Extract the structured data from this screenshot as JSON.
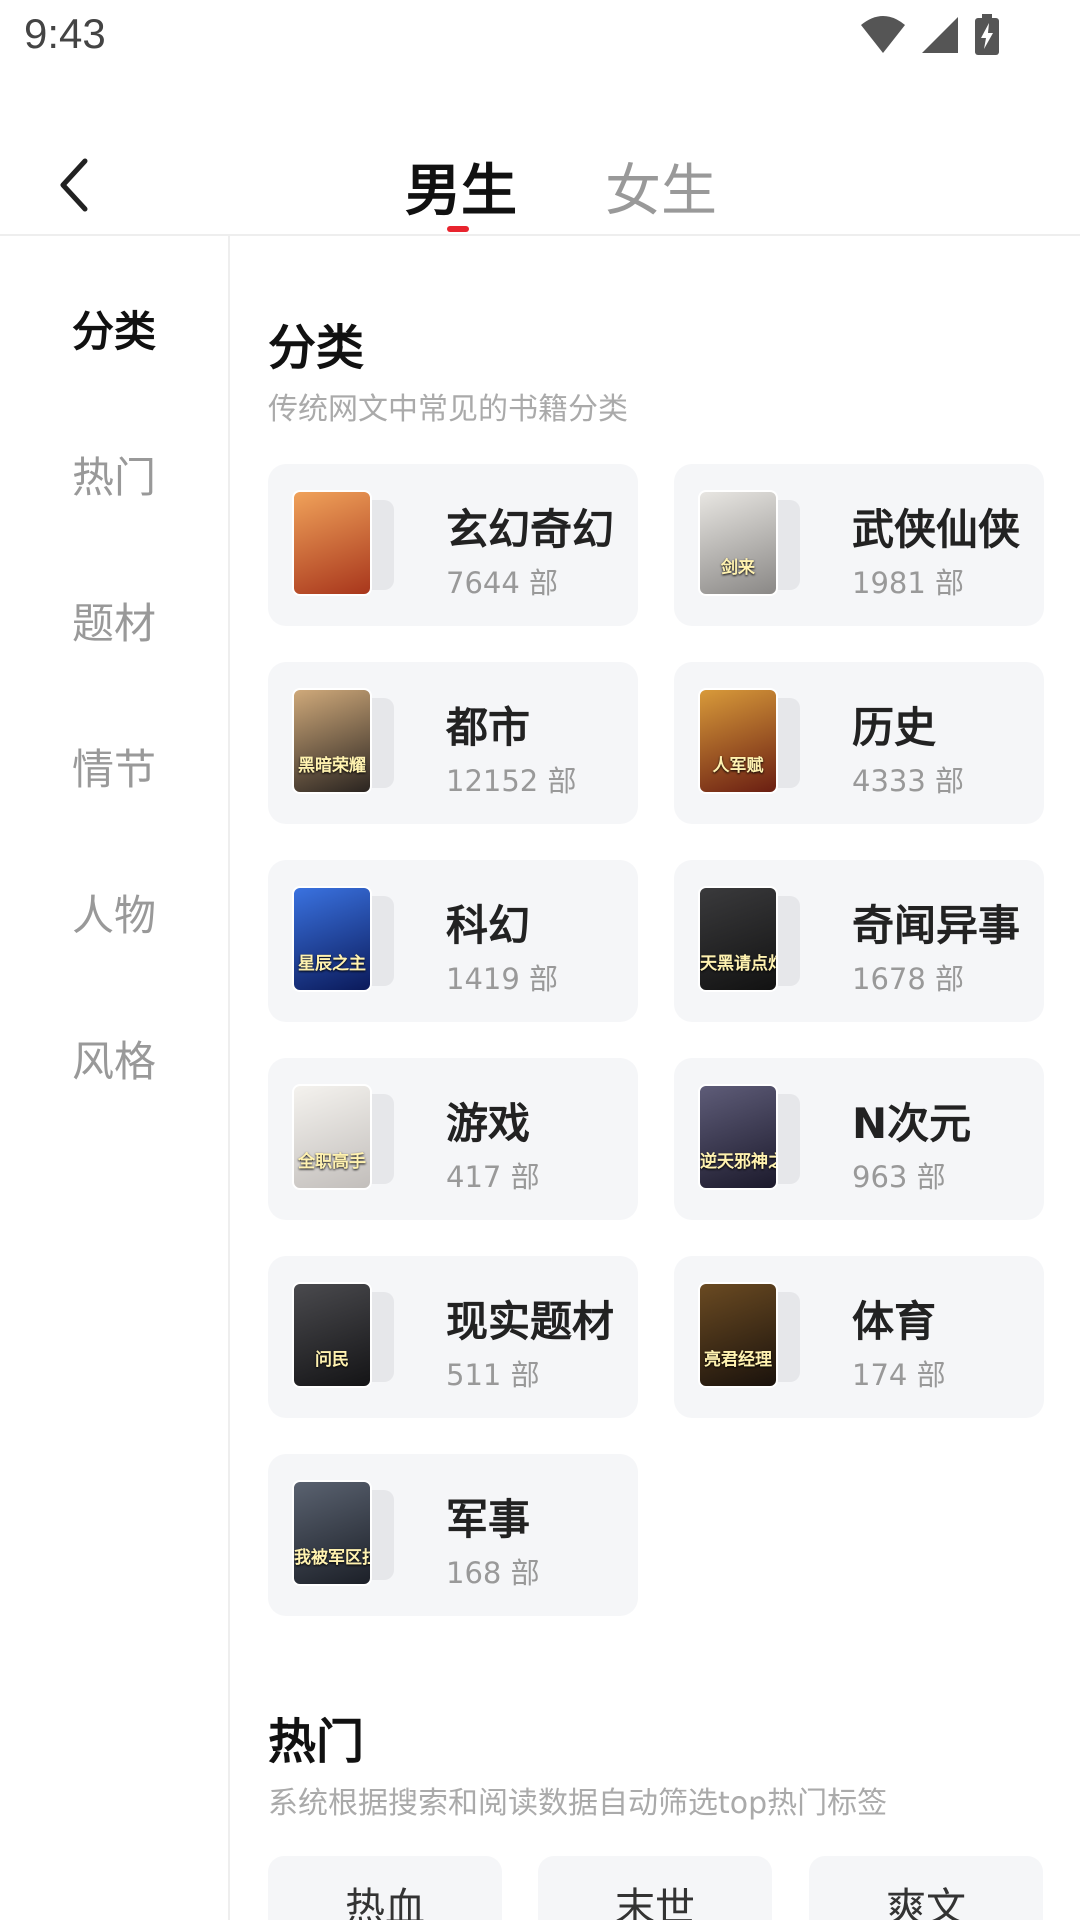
{
  "status_bar": {
    "time": "9:43"
  },
  "tabs": [
    {
      "label": "男生",
      "active": true
    },
    {
      "label": "女生",
      "active": false
    }
  ],
  "sidebar": {
    "items": [
      {
        "label": "分类",
        "active": true
      },
      {
        "label": "热门",
        "active": false
      },
      {
        "label": "题材",
        "active": false
      },
      {
        "label": "情节",
        "active": false
      },
      {
        "label": "人物",
        "active": false
      },
      {
        "label": "风格",
        "active": false
      }
    ]
  },
  "category_section": {
    "title": "分类",
    "subtitle": "传统网文中常见的书籍分类",
    "items": [
      {
        "name": "玄幻奇幻",
        "count": "7644 部",
        "cover_colors": [
          "#f0a25a",
          "#a8361c"
        ]
      },
      {
        "name": "武侠仙侠",
        "count": "1981 部",
        "cover_colors": [
          "#e8e6e2",
          "#8a8886"
        ],
        "cover_text": "剑来"
      },
      {
        "name": "都市",
        "count": "12152 部",
        "cover_colors": [
          "#cfa97a",
          "#2a2420"
        ],
        "cover_text": "黑暗荣耀"
      },
      {
        "name": "历史",
        "count": "4333 部",
        "cover_colors": [
          "#d89a3a",
          "#6a1e12"
        ],
        "cover_text": "人军赋"
      },
      {
        "name": "科幻",
        "count": "1419 部",
        "cover_colors": [
          "#3a72e0",
          "#0b1a5a"
        ],
        "cover_text": "星辰之主"
      },
      {
        "name": "奇闻异事",
        "count": "1678 部",
        "cover_colors": [
          "#3a3a3c",
          "#121212"
        ],
        "cover_text": "天黑请点灯"
      },
      {
        "name": "游戏",
        "count": "417 部",
        "cover_colors": [
          "#f4f2ee",
          "#c2bebb"
        ],
        "cover_text": "全职高手"
      },
      {
        "name": "N次元",
        "count": "963 部",
        "cover_colors": [
          "#5e5c78",
          "#1c1a2c"
        ],
        "cover_text": "逆天邪神之续章"
      },
      {
        "name": "现实题材",
        "count": "511 部",
        "cover_colors": [
          "#4a4a4e",
          "#141416"
        ],
        "cover_text": "问民"
      },
      {
        "name": "体育",
        "count": "174 部",
        "cover_colors": [
          "#6a4a22",
          "#1a120c"
        ],
        "cover_text": "亮君经理"
      },
      {
        "name": "军事",
        "count": "168 部",
        "cover_colors": [
          "#5a6270",
          "#1c2028"
        ],
        "cover_text": "我被军区拉进黑名单"
      }
    ]
  },
  "hot_section": {
    "title": "热门",
    "subtitle": "系统根据搜索和阅读数据自动筛选top热门标签",
    "tags": [
      "热血",
      "末世",
      "爽文"
    ]
  }
}
